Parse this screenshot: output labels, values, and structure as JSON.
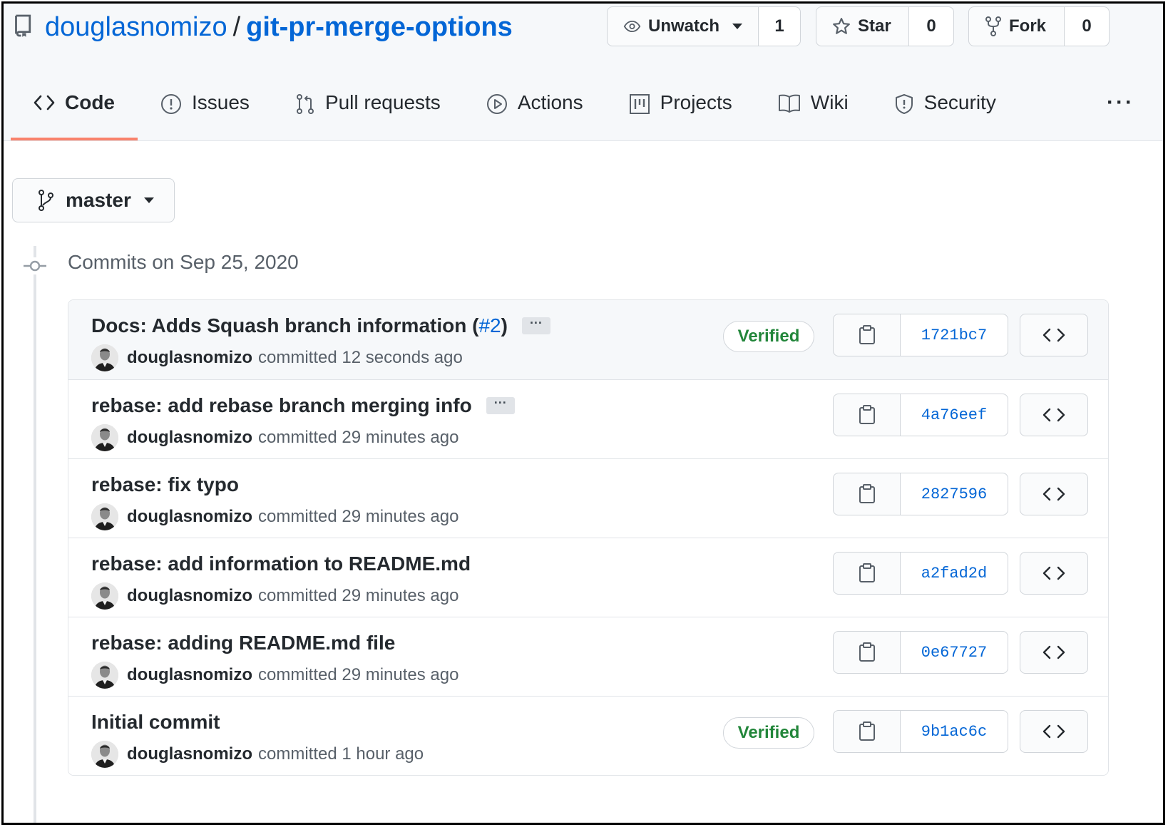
{
  "repo": {
    "owner": "douglasnomizo",
    "separator": "/",
    "name": "git-pr-merge-options"
  },
  "actions": {
    "watch": {
      "label": "Unwatch",
      "count": "1"
    },
    "star": {
      "label": "Star",
      "count": "0"
    },
    "fork": {
      "label": "Fork",
      "count": "0"
    }
  },
  "tabs": [
    {
      "label": "Code",
      "icon": "code-icon",
      "selected": true
    },
    {
      "label": "Issues",
      "icon": "issue-icon"
    },
    {
      "label": "Pull requests",
      "icon": "pull-request-icon"
    },
    {
      "label": "Actions",
      "icon": "play-icon"
    },
    {
      "label": "Projects",
      "icon": "project-icon"
    },
    {
      "label": "Wiki",
      "icon": "book-icon"
    },
    {
      "label": "Security",
      "icon": "shield-icon"
    }
  ],
  "more_label": "···",
  "branch": {
    "label": "master"
  },
  "commits_date": "Commits on Sep 25, 2020",
  "commits": [
    {
      "message": "Docs: Adds Squash branch information (",
      "pr": "#2",
      "message_end": ")",
      "has_ellipsis": true,
      "author": "douglasnomizo",
      "time": "committed 12 seconds ago",
      "verified": "Verified",
      "sha": "1721bc7"
    },
    {
      "message": "rebase: add rebase branch merging info",
      "has_ellipsis": true,
      "author": "douglasnomizo",
      "time": "committed 29 minutes ago",
      "sha": "4a76eef"
    },
    {
      "message": "rebase: fix typo",
      "author": "douglasnomizo",
      "time": "committed 29 minutes ago",
      "sha": "2827596"
    },
    {
      "message": "rebase: add information to README.md",
      "author": "douglasnomizo",
      "time": "committed 29 minutes ago",
      "sha": "a2fad2d"
    },
    {
      "message": "rebase: adding README.md file",
      "author": "douglasnomizo",
      "time": "committed 29 minutes ago",
      "sha": "0e67727"
    },
    {
      "message": "Initial commit",
      "author": "douglasnomizo",
      "time": "committed 1 hour ago",
      "verified": "Verified",
      "sha": "9b1ac6c"
    }
  ],
  "ellipsis_label": "···"
}
